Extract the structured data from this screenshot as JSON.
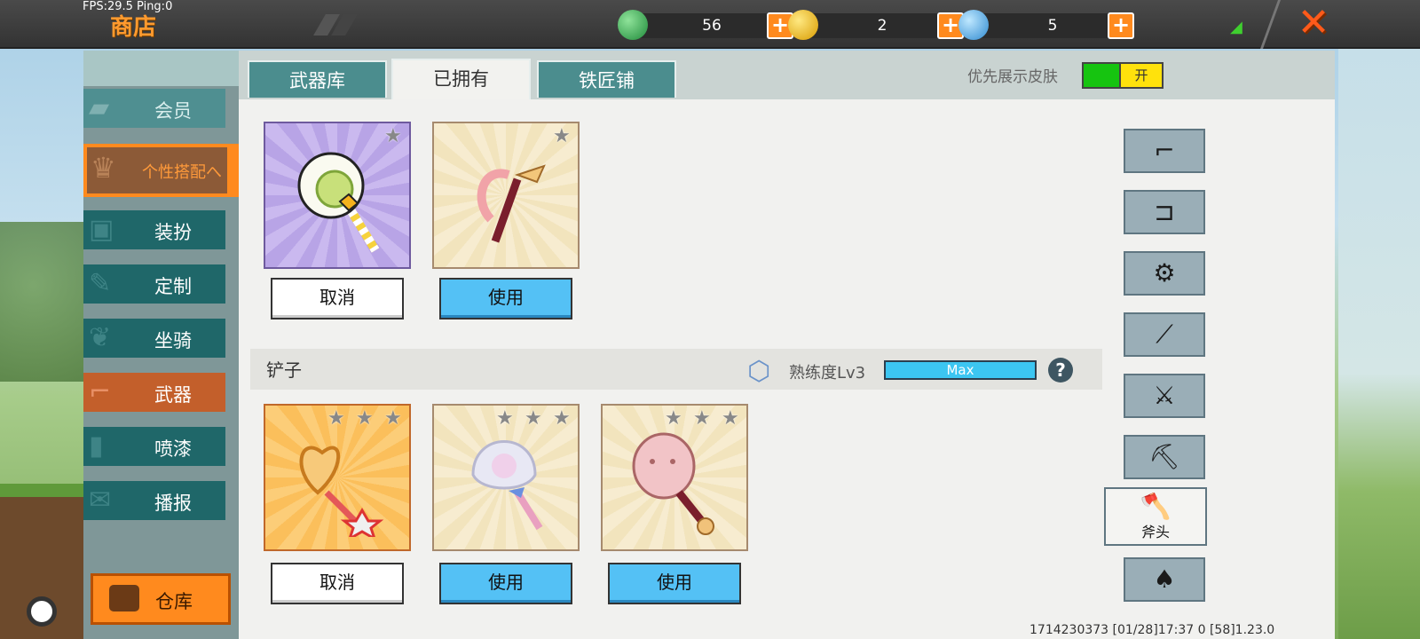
{
  "topbar": {
    "fps": "FPS:29.5  Ping:0",
    "title": "商店",
    "currencies": [
      {
        "name": "green-gem",
        "value": "56",
        "color": "#2fa84a"
      },
      {
        "name": "gold-coin",
        "value": "2",
        "color": "#f3c21a"
      },
      {
        "name": "blue-coin",
        "value": "5",
        "color": "#3aa7e0"
      }
    ],
    "plus": "+",
    "close": "✕"
  },
  "sidebar": {
    "vip": "会员",
    "personal": "个性搭配へ",
    "items": [
      {
        "label": "装扮",
        "icon": "shirt-icon"
      },
      {
        "label": "定制",
        "icon": "pencil-icon"
      },
      {
        "label": "坐骑",
        "icon": "mount-icon"
      },
      {
        "label": "武器",
        "icon": "gun-icon"
      },
      {
        "label": "喷漆",
        "icon": "spray-icon"
      },
      {
        "label": "播报",
        "icon": "broadcast-icon"
      }
    ],
    "warehouse": "仓库"
  },
  "tabs": [
    {
      "label": "武器库"
    },
    {
      "label": "已拥有"
    },
    {
      "label": "铁匠铺"
    }
  ],
  "skin_toggle": {
    "label": "优先展示皮肤",
    "state": "开"
  },
  "row1": {
    "buttons": [
      "取消",
      "使用"
    ]
  },
  "section": {
    "title": "铲子",
    "proficiency": "熟练度Lv3",
    "bar": "Max",
    "help": "?"
  },
  "row2": {
    "buttons": [
      "取消",
      "使用",
      "使用"
    ]
  },
  "categories": {
    "active_label": "斧头"
  },
  "footer": "1714230373      [01/28]17:37 0      [58]1.23.0",
  "colors": {
    "accent": "#ff8a1e",
    "teal": "#1f6769",
    "blue_btn": "#54c1f5"
  }
}
